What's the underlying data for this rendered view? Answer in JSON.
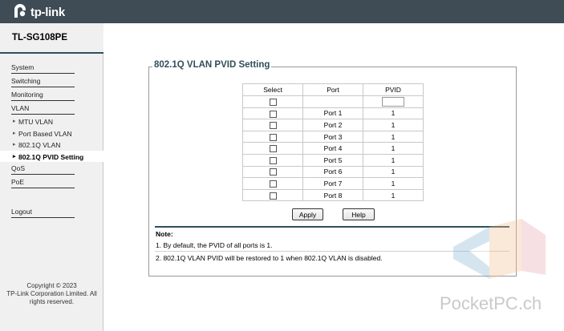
{
  "header": {
    "brand": "tp-link",
    "logo_icon": "tp-link-logo-icon"
  },
  "device": {
    "model": "TL-SG108PE"
  },
  "sidebar": {
    "items": [
      {
        "label": "System",
        "type": "section"
      },
      {
        "label": "Switching",
        "type": "section"
      },
      {
        "label": "Monitoring",
        "type": "section"
      },
      {
        "label": "VLAN",
        "type": "section-open"
      },
      {
        "label": "MTU VLAN",
        "type": "sub"
      },
      {
        "label": "Port Based VLAN",
        "type": "sub"
      },
      {
        "label": "802.1Q VLAN",
        "type": "sub"
      },
      {
        "label": "802.1Q PVID Setting",
        "type": "sub",
        "active": true
      },
      {
        "label": "QoS",
        "type": "section"
      },
      {
        "label": "PoE",
        "type": "section"
      },
      {
        "label": "Logout",
        "type": "section"
      }
    ],
    "copyright": "Copyright © 2023\nTP-Link Corporation Limited. All rights reserved."
  },
  "main": {
    "title": "802.1Q VLAN PVID Setting",
    "table": {
      "headers": [
        "Select",
        "Port",
        "PVID"
      ],
      "rows": [
        {
          "port": "Port 1",
          "pvid": "1"
        },
        {
          "port": "Port 2",
          "pvid": "1"
        },
        {
          "port": "Port 3",
          "pvid": "1"
        },
        {
          "port": "Port 4",
          "pvid": "1"
        },
        {
          "port": "Port 5",
          "pvid": "1"
        },
        {
          "port": "Port 6",
          "pvid": "1"
        },
        {
          "port": "Port 7",
          "pvid": "1"
        },
        {
          "port": "Port 8",
          "pvid": "1"
        }
      ],
      "pvid_input_value": ""
    },
    "buttons": {
      "apply": "Apply",
      "help": "Help"
    },
    "note": {
      "title": "Note:",
      "lines": [
        "1. By default, the PVID of all ports is 1.",
        "2. 802.1Q VLAN PVID will be restored to 1 when 802.1Q VLAN is disabled."
      ]
    }
  },
  "watermark": {
    "text": "PocketPC.ch",
    "icon": "pocketpc-logo-icon"
  },
  "colors": {
    "topbar": "#3f4b55",
    "accent": "#2f4f5b",
    "sidebar_bg": "#f0f0f0"
  }
}
